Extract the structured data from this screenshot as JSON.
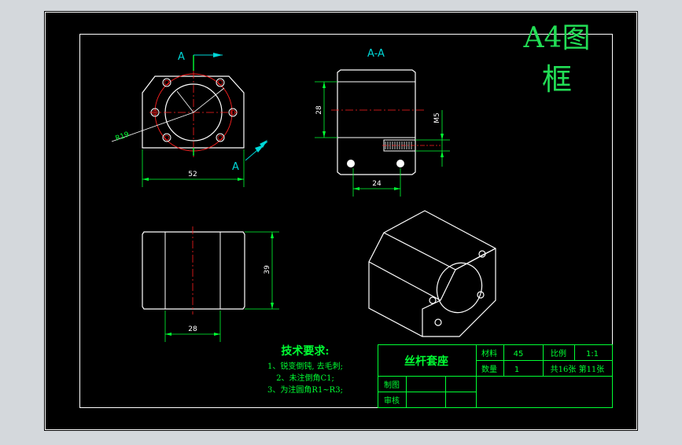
{
  "frame": {
    "title_line1": "A4图",
    "title_line2": "框"
  },
  "colors": {
    "background_outer": "#d4d8dc",
    "sheet": "#000000",
    "border": "#ffffff",
    "accent_green": "#00ff33",
    "dim_cyan": "#00d8d8",
    "center_red": "#ff2020",
    "title_green": "#22dd55"
  },
  "views": {
    "front": {
      "section_mark_top": "A",
      "section_mark_bottom": "A",
      "radius_label": "R19",
      "width_dim": "52"
    },
    "section": {
      "title": "A-A",
      "height_dim": "28",
      "thread_label": "M5",
      "width_dim": "24"
    },
    "side": {
      "height_dim": "39",
      "width_dim": "28"
    }
  },
  "notes": {
    "title": "技术要求:",
    "items": [
      "1、锐变倒钝, 去毛刺;",
      "2、未注倒角C1;",
      "3、为注圆角R1~R3;"
    ]
  },
  "title_block": {
    "part_name": "丝杆套座",
    "material_label": "材料",
    "material_value": "45",
    "scale_label": "比例",
    "scale_value": "1:1",
    "qty_label": "数量",
    "qty_value": "1",
    "sheet_info": "共16张  第11张",
    "drawn_label": "制图",
    "checked_label": "审核"
  }
}
